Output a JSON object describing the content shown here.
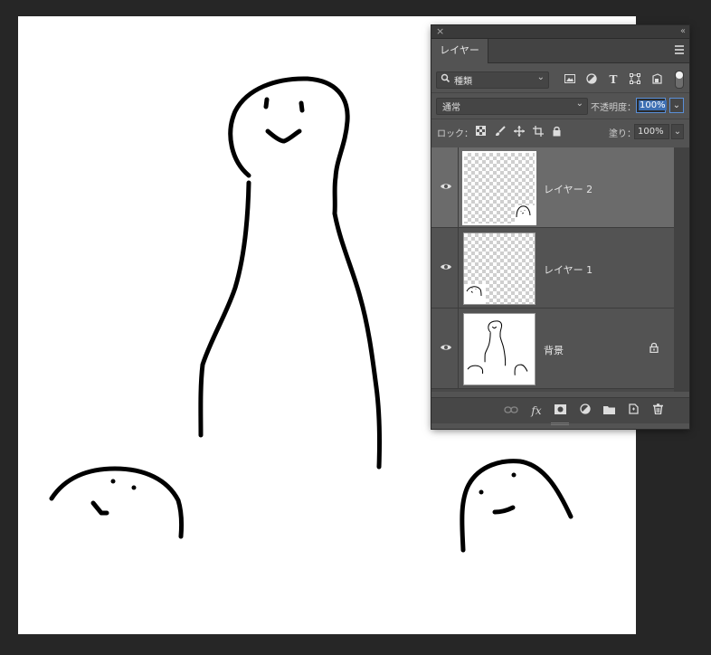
{
  "panel": {
    "close_glyph": "×",
    "collapse_glyph": "‹‹",
    "tab_label": "レイヤー",
    "menu_icon": "hamburger-menu-icon"
  },
  "filter": {
    "kind_label": "種類",
    "kind_icons": [
      "image-filter-icon",
      "adjustment-filter-icon",
      "type-filter-icon",
      "shape-filter-icon",
      "smart-object-filter-icon"
    ],
    "toggle_state": "on"
  },
  "blend": {
    "mode": "通常",
    "opacity_label": "不透明度：",
    "opacity_value": "100%"
  },
  "lock": {
    "label": "ロック：",
    "icons": [
      "lock-transparent-icon",
      "lock-pixels-icon",
      "lock-position-icon",
      "lock-artboard-icon",
      "lock-all-icon"
    ],
    "fill_label": "塗り：",
    "fill_value": "100%"
  },
  "layers": [
    {
      "name": "レイヤー 2",
      "selected": true,
      "visible": true,
      "locked": false
    },
    {
      "name": "レイヤー 1",
      "selected": false,
      "visible": true,
      "locked": false
    },
    {
      "name": "背景",
      "selected": false,
      "visible": true,
      "locked": true
    }
  ],
  "bottom_actions": [
    "link-layers-icon",
    "fx-icon",
    "add-mask-icon",
    "new-adjustment-icon",
    "new-group-icon",
    "new-layer-icon",
    "delete-layer-icon"
  ],
  "bottom_fx_label": "fx",
  "colors": {
    "app_bg": "#262626",
    "panel_bg": "#535353",
    "selected_layer": "#6b6b6b",
    "accent": "#5a8fd8",
    "canvas": "#ffffff"
  }
}
